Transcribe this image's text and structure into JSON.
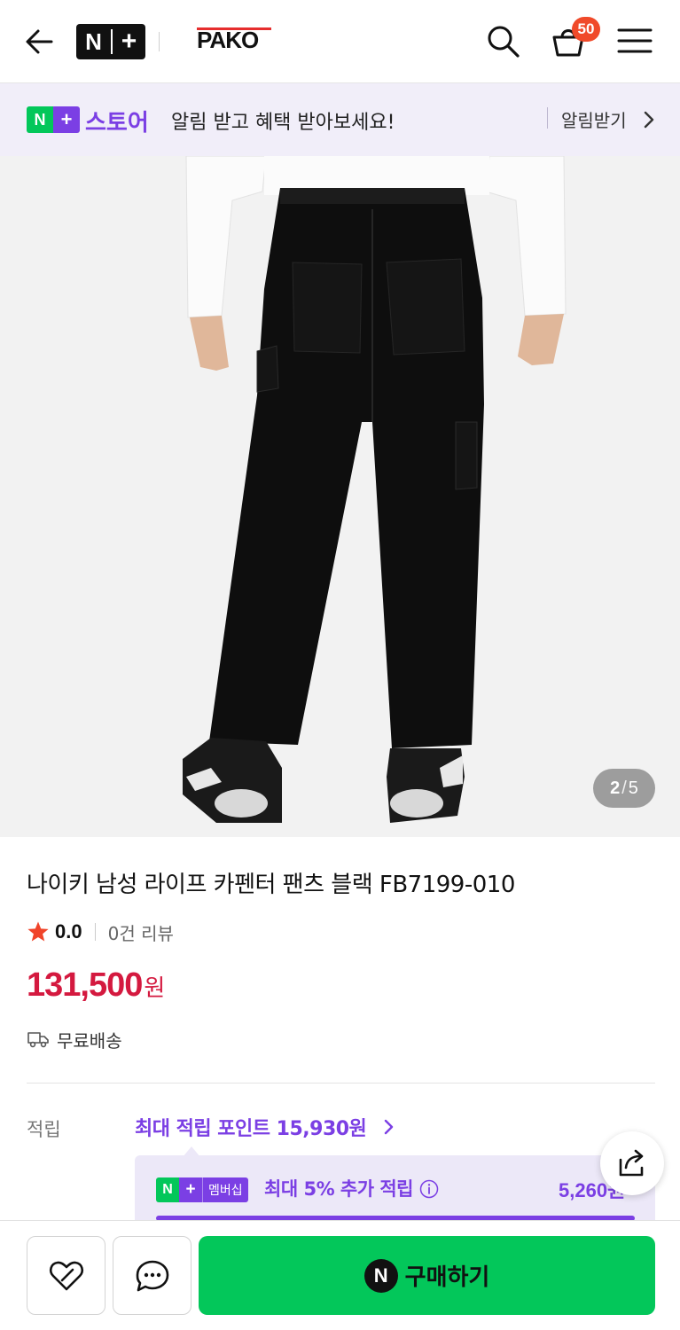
{
  "header": {
    "logo_n": "N",
    "logo_plus": "+",
    "brand": "PAKO",
    "cart_count": "50",
    "icons": [
      "back-arrow-icon",
      "search-icon",
      "cart-icon",
      "menu-icon"
    ]
  },
  "notice": {
    "badge_n": "N",
    "badge_plus": "+",
    "store_label": "스토어",
    "message": "알림 받고 혜택 받아보세요!",
    "action": "알림받기"
  },
  "gallery": {
    "current": "2",
    "separator": "/",
    "total": "5"
  },
  "product": {
    "title": "나이키 남성 라이프 카펜터 팬츠 블랙 FB7199-010",
    "rating": "0.0",
    "reviews": "0건 리뷰",
    "price": "131,500",
    "price_unit": "원",
    "shipping": "무료배송"
  },
  "points": {
    "label": "적립",
    "value": "최대 적립 포인트 15,930원",
    "membership_badge_n": "N",
    "membership_badge_plus": "+",
    "membership_tag": "멤버십",
    "membership_text": "최대 5% 추가 적립",
    "membership_amount": "5,260원"
  },
  "bottom": {
    "buy_logo": "N",
    "buy_label": "구매하기"
  },
  "colors": {
    "naver_green": "#03c75a",
    "accent_purple": "#7b3fe4",
    "price_red": "#d4193f",
    "badge_red": "#f04a2a"
  }
}
